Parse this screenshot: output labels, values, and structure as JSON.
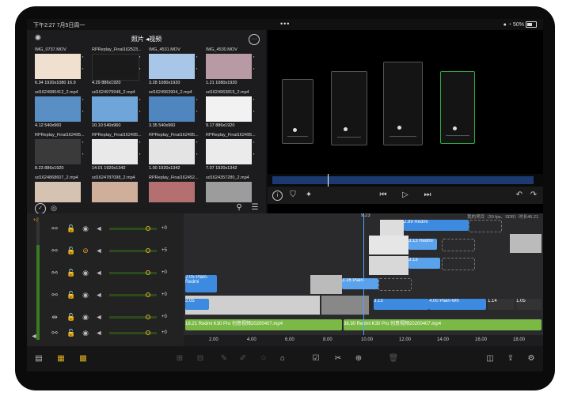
{
  "status": {
    "time": "下午2:27",
    "date": "7月5日周一",
    "dots": "•••",
    "battery": "50%"
  },
  "browser": {
    "title": "照片 ◂视频",
    "clips": [
      {
        "name": "IMG_0737.MOV",
        "meta": "6.34  1920x1080  16.9"
      },
      {
        "name": "RPReplay_Final162523...",
        "meta": "4.29  886x1920"
      },
      {
        "name": "IMG_4531.MOV",
        "meta": "3.28  1080x1920"
      },
      {
        "name": "IMG_4530.MOV",
        "meta": "1.21  1080x1920"
      },
      {
        "name": "sd1624980412_2.mp4",
        "meta": "4.12  540x960"
      },
      {
        "name": "sd1624979948_2.mp4",
        "meta": "10.10  540x960"
      },
      {
        "name": "sd1624963904_2.mp4",
        "meta": "3.35  540x960"
      },
      {
        "name": "sd1624963819_2.mp4",
        "meta": "9.17  886x1920"
      },
      {
        "name": "RPReplay_Final162495...",
        "meta": "8.23  886x1920"
      },
      {
        "name": "RPReplay_Final162495...",
        "meta": "14.01  1920x1342"
      },
      {
        "name": "RPReplay_Final162495...",
        "meta": "1.00  1920x1342"
      },
      {
        "name": "RPReplay_Final162495...",
        "meta": "7.07  1920x1342"
      },
      {
        "name": "sd1624868607_2.mp4",
        "meta": ""
      },
      {
        "name": "sd1624787098_2.mp4",
        "meta": ""
      },
      {
        "name": "RPReplay_Final162452...",
        "meta": ""
      },
      {
        "name": "sd1624357280_2.mp4",
        "meta": ""
      }
    ]
  },
  "timeline": {
    "playhead": "9.23",
    "project": "我的项目（30 fps、SDR）时长46.21",
    "db": [
      "+0",
      "+5",
      "+0",
      "+0",
      "+0",
      "+0"
    ],
    "meter_top": "+2",
    "clips": {
      "c1": "2.05  Plain-",
      "c1b": "Redmi",
      "c2": "3.16  Plain-",
      "c3": "3.13  Redmi",
      "c4": "3.13",
      "c5": "3.13",
      "c6": "4.00  Plain-Wh",
      "c7": "1.14",
      "c8": "1.05",
      "c9": "2.05",
      "c10": "2.99  Redmi",
      "a1": "18.21  Redmi K30 Pro 创意视频20200407.mp4",
      "a2": "38.30  Redmi K30 Pro 创意视频20200407.mp4"
    },
    "ruler": [
      "2.00",
      "4.00",
      "6.00",
      "8.00",
      "10.00",
      "12.00",
      "14.00",
      "16.00",
      "18.00"
    ]
  },
  "icons": {
    "gear": "settings-gear-icon",
    "more": "more-options-icon"
  }
}
